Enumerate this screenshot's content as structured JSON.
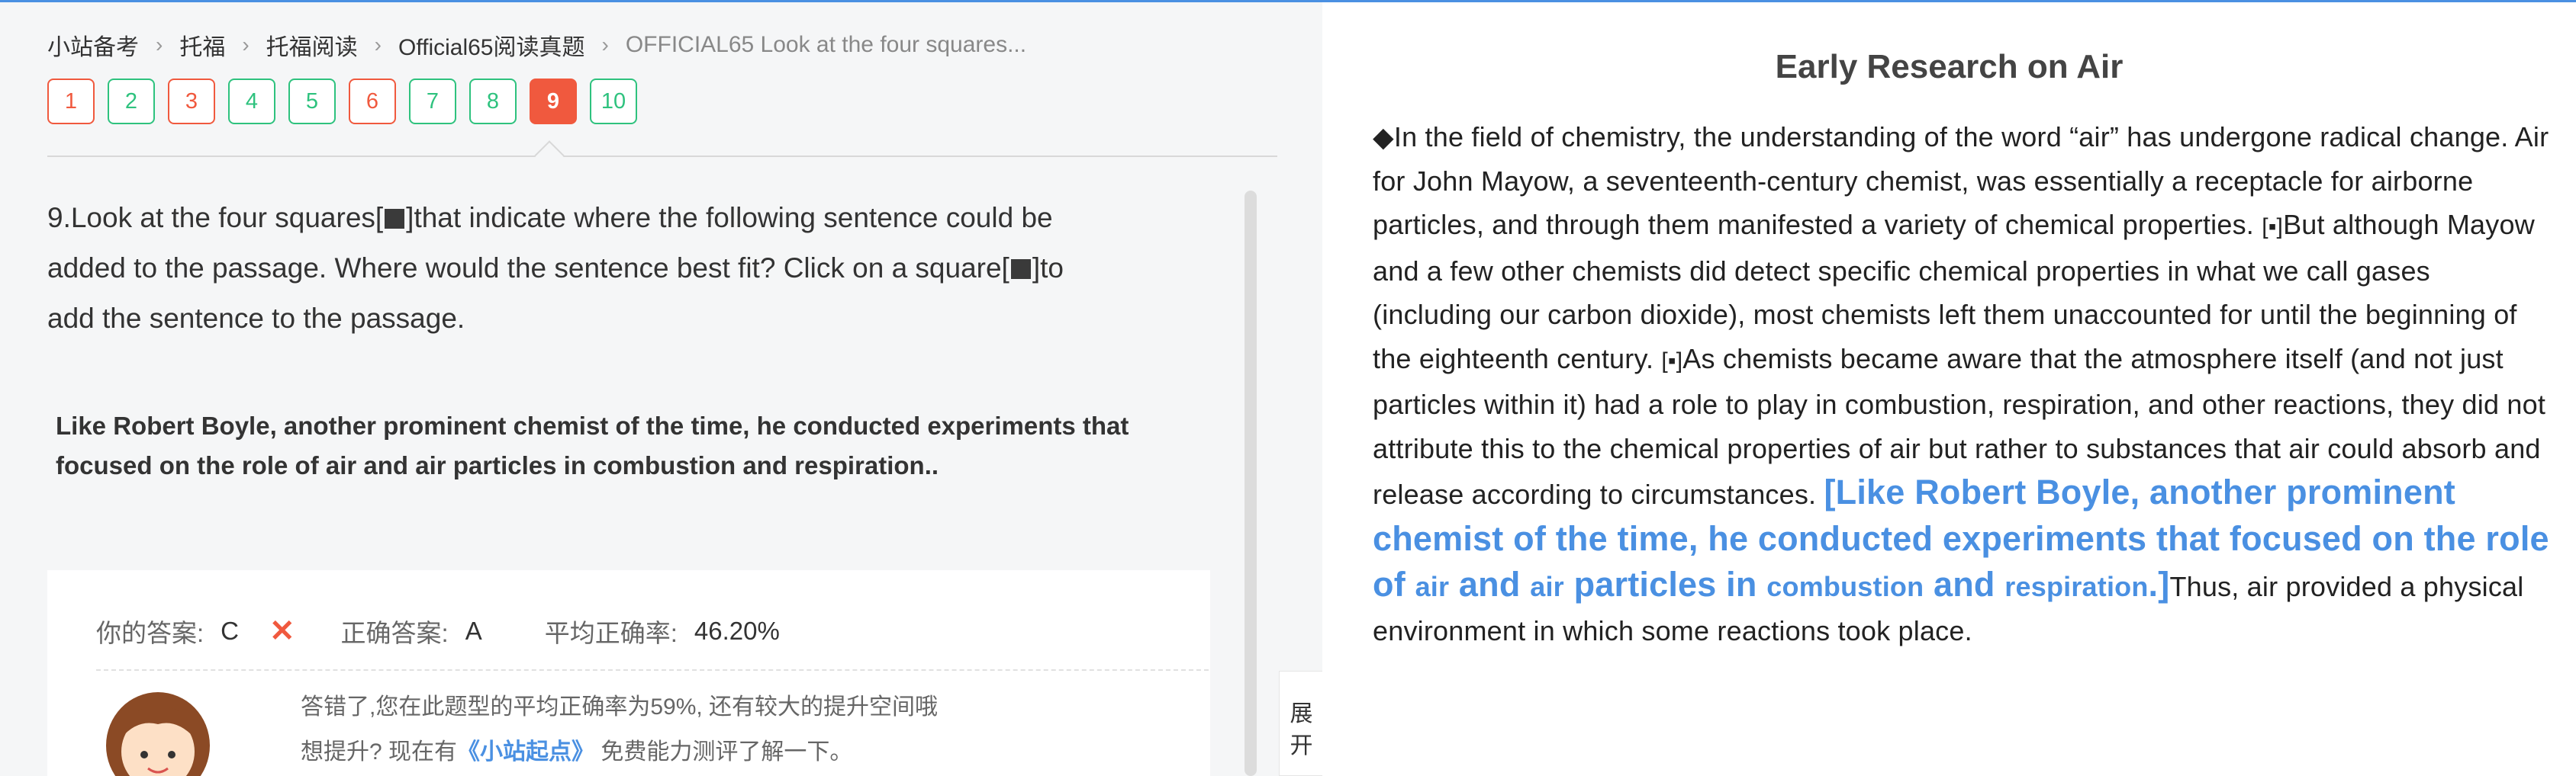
{
  "breadcrumb": {
    "items": [
      "小站备考",
      "托福",
      "托福阅读",
      "Official65阅读真题",
      "OFFICIAL65 Look at the four squares..."
    ]
  },
  "question_nav": {
    "buttons": [
      {
        "label": "1",
        "state": "wrong"
      },
      {
        "label": "2",
        "state": "correct"
      },
      {
        "label": "3",
        "state": "wrong"
      },
      {
        "label": "4",
        "state": "correct"
      },
      {
        "label": "5",
        "state": "correct"
      },
      {
        "label": "6",
        "state": "wrong"
      },
      {
        "label": "7",
        "state": "correct"
      },
      {
        "label": "8",
        "state": "correct"
      },
      {
        "label": "9",
        "state": "current"
      },
      {
        "label": "10",
        "state": "correct"
      }
    ]
  },
  "question": {
    "part1": "9.Look at the four squares[",
    "part2": "]that indicate where the following sentence could be added to the passage. Where would the sentence best fit? Click on a square[",
    "part3": "]to add the sentence to the passage."
  },
  "insert_sentence": "Like Robert Boyle, another prominent chemist of the time, he conducted experiments that focused on the role of air and air particles in combustion and respiration..",
  "answer": {
    "your_label": "你的答案:",
    "your_value": "C",
    "correct_label": "正确答案:",
    "correct_value": "A",
    "avg_label": "平均正确率:",
    "avg_value": "46.20%",
    "wrong_mark": "✕",
    "feedback_line1": "答错了,您在此题型的平均正确率为59%, 还有较大的提升空间哦",
    "feedback_line2_a": "想提升? 现在有",
    "feedback_link": "《小站起点》",
    "feedback_line2_b": " 免费能力测评了解一下。"
  },
  "expand": {
    "label1": "展",
    "label2": "开"
  },
  "passage": {
    "title": "Early Research on Air",
    "diamond": "◆",
    "text1": "In the field of chemistry, the understanding of the word “air” has undergone radical change. Air for John Mayow, a seventeenth-century chemist, was essentially a receptacle for airborne particles, and through them manifested a variety of chemical properties. ",
    "square_a": "[▪]",
    "text2": "But although Mayow and a few other chemists did detect specific chemical properties in what we call gases (including our carbon dioxide), most chemists left them unaccounted for until the beginning of the eighteenth century. ",
    "square_b": "[▪]",
    "text3": "As chemists became aware that the atmosphere itself (and not just particles within it) had a role to play in combustion, respiration, and other reactions, they did not attribute this to the chemical properties of air but rather to substances that air could absorb and release according to circumstances. ",
    "inserted_a": "[Like Robert Boyle, another prominent chemist of the time, he conducted experiments that focused on the role of ",
    "inserted_air1": "air",
    "inserted_and1": " and ",
    "inserted_air2": "air",
    "inserted_particles": " particles in ",
    "inserted_combustion": "combustion",
    "inserted_and2": " and ",
    "inserted_respiration": "respiration",
    "inserted_end": ".]",
    "text4": "Thus, air provided a physical environment in which some reactions took place."
  },
  "colors": {
    "correct": "#2ec27e",
    "wrong": "#f0593e",
    "highlight": "#4a90e2"
  }
}
